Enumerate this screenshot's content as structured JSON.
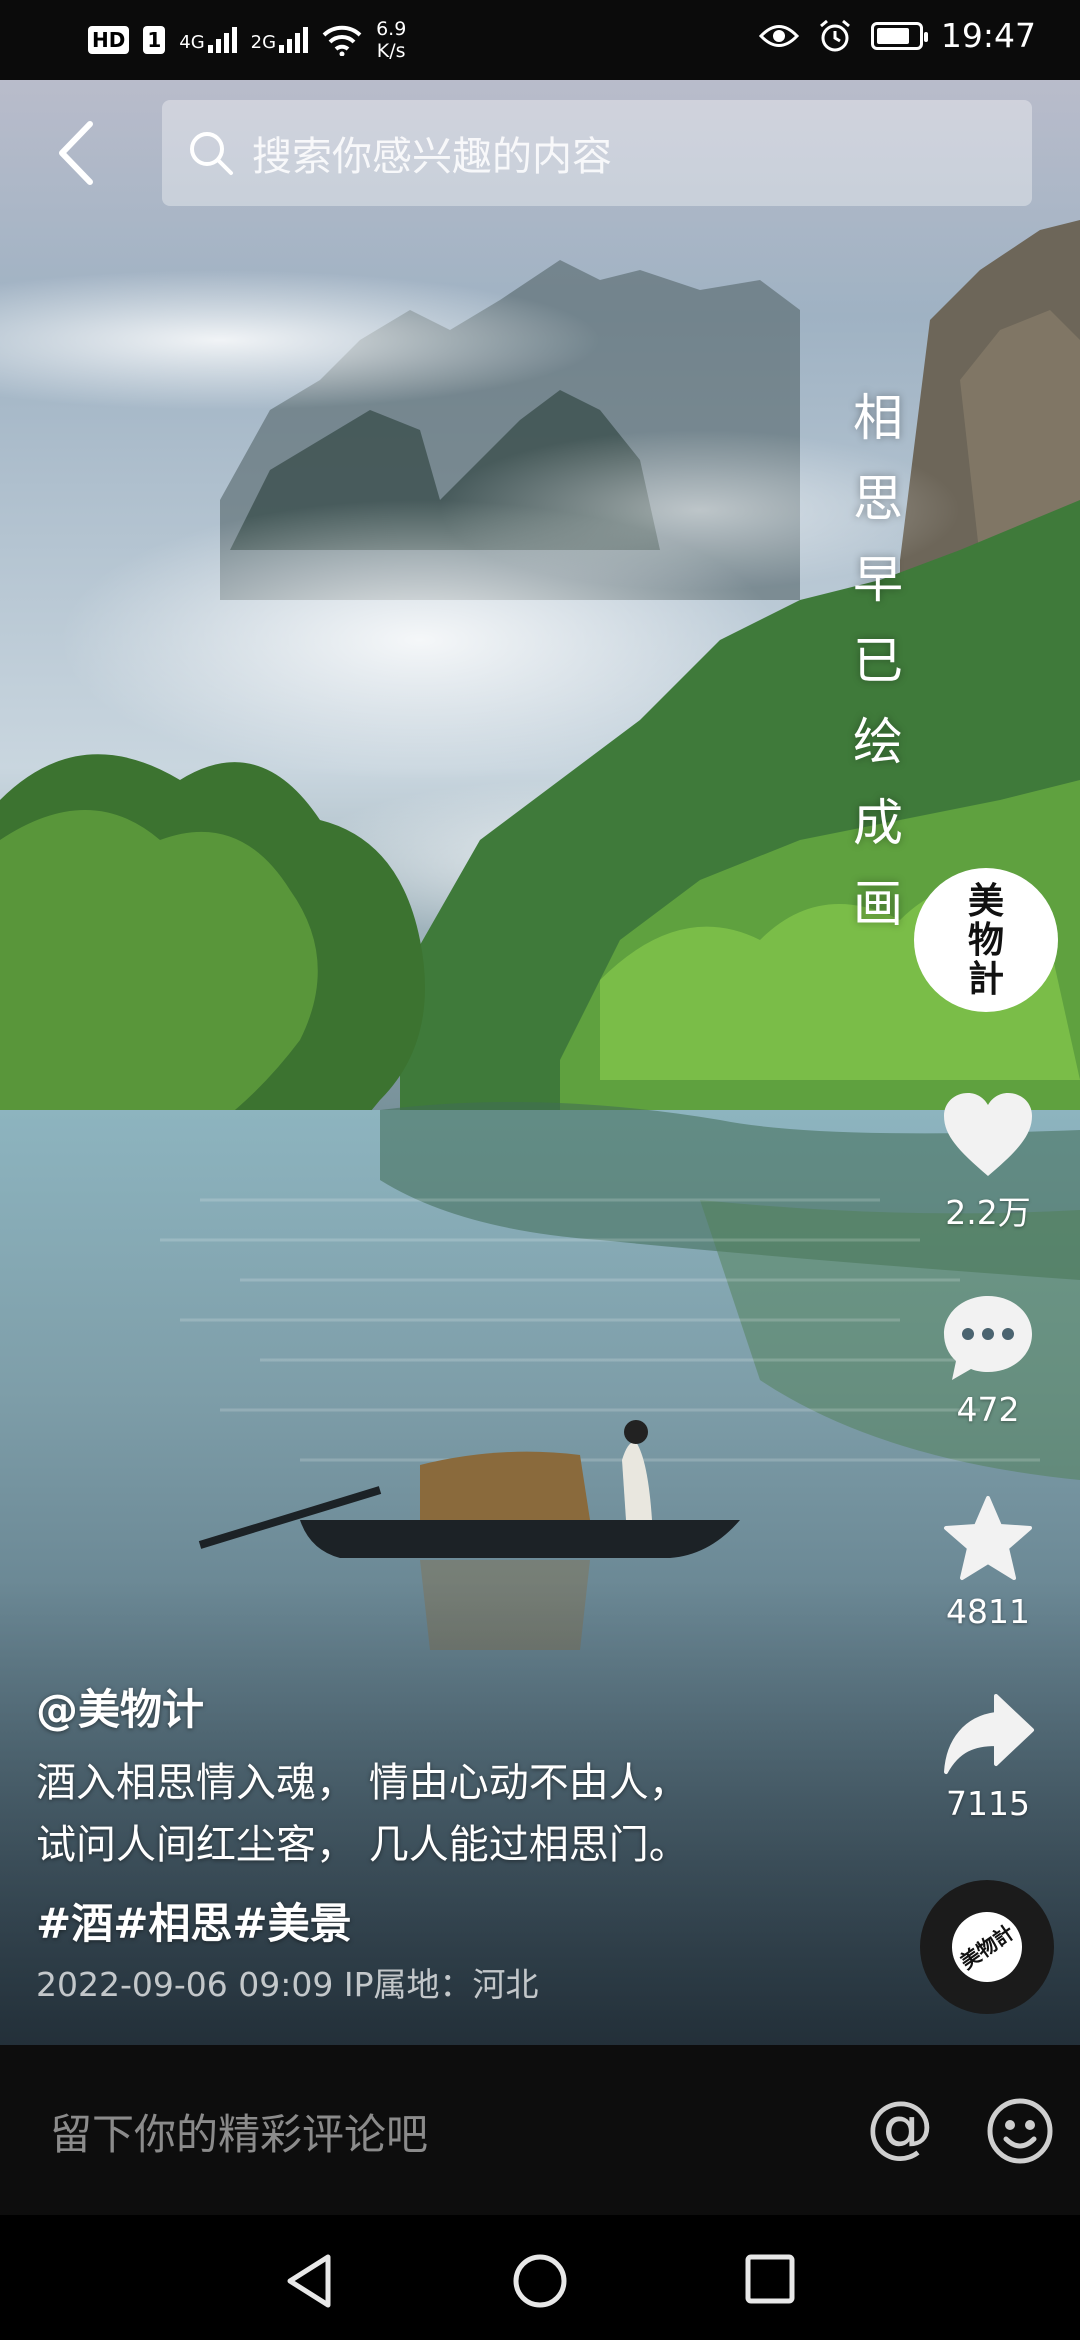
{
  "status_bar": {
    "hd": "HD",
    "sim": "1",
    "net1": "4G",
    "net2": "2G",
    "speed_value": "6.9",
    "speed_unit": "K/s",
    "time": "19:47"
  },
  "search": {
    "placeholder": "搜索你感兴趣的内容"
  },
  "video": {
    "overlay_title_chars": [
      "相",
      "思",
      "早",
      "已",
      "绘",
      "成",
      "画"
    ]
  },
  "creator": {
    "avatar_chars": [
      "美",
      "物",
      "計"
    ],
    "disc_text": "美物計"
  },
  "actions": {
    "likes": "2.2万",
    "comments": "472",
    "favorites": "4811",
    "shares": "7115"
  },
  "caption": {
    "author": "@美物计",
    "line1": "酒入相思情入魂， 情由心动不由人，",
    "line2": "试问人间红尘客， 几人能过相思门。",
    "hashtags": "#酒#相思#美景",
    "meta": "2022-09-06 09:09  IP属地：河北"
  },
  "comment_bar": {
    "placeholder": "留下你的精彩评论吧",
    "at_symbol": "@"
  },
  "icons": [
    "back-icon",
    "search-icon",
    "heart-icon",
    "comment-icon",
    "star-icon",
    "share-icon",
    "emoji-icon",
    "nav-back-icon",
    "nav-home-icon",
    "nav-recents-icon"
  ]
}
